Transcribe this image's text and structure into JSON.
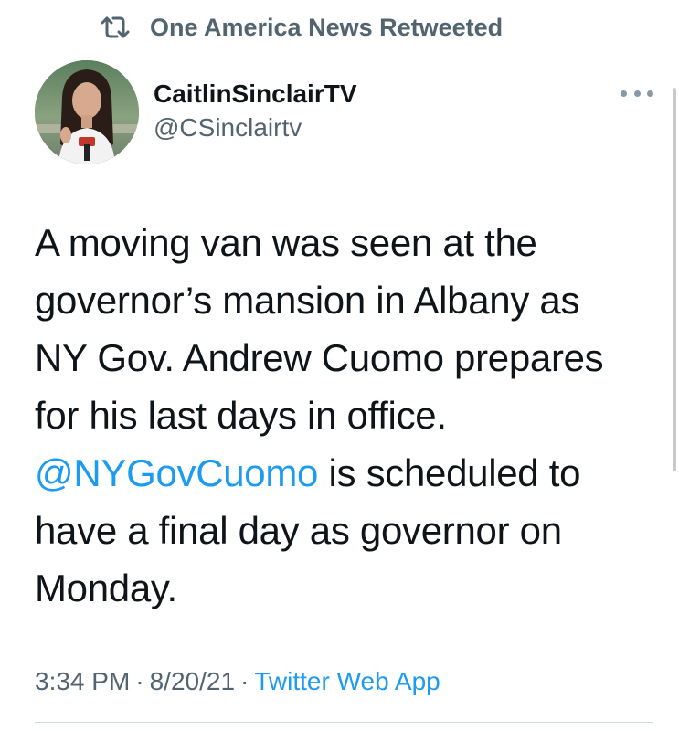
{
  "retweet": {
    "icon": "retweet-icon",
    "label": "One America News Retweeted"
  },
  "author": {
    "avatar": "profile-photo",
    "display_name": "CaitlinSinclairTV",
    "handle": "@CSinclairtv"
  },
  "menu": {
    "icon": "more-options-icon"
  },
  "tweet": {
    "line_1": "A moving van was seen at the",
    "line_2": "governor’s mansion in Albany as",
    "line_3": "NY Gov. Andrew Cuomo prepares",
    "line_4": "for his last days in office.",
    "mention": "@NYGovCuomo",
    "line_5_rest": " is scheduled to",
    "line_6": "have a final day as governor on",
    "line_7": "Monday."
  },
  "meta": {
    "time": "3:34 PM",
    "separator": "·",
    "date": "8/20/21",
    "source": "Twitter Web App"
  },
  "colors": {
    "link": "#1d9bf0",
    "muted": "#536471",
    "text": "#0f1419"
  }
}
